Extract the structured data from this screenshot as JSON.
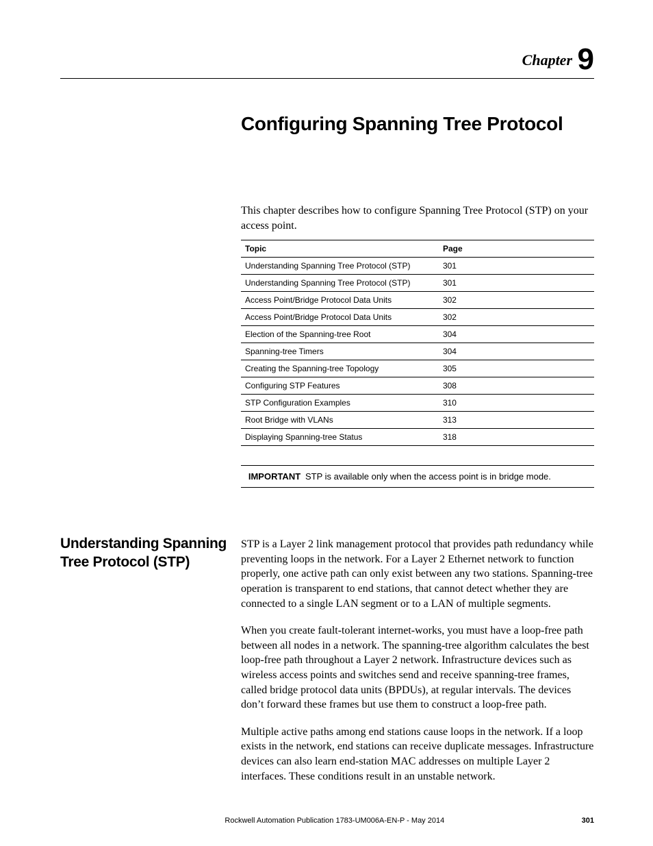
{
  "header": {
    "chapter_word": "Chapter",
    "chapter_num": "9"
  },
  "title": "Configuring Spanning Tree Protocol",
  "intro": "This chapter describes how to configure Spanning Tree Protocol (STP) on your access point.",
  "topics_table": {
    "head_topic": "Topic",
    "head_page": "Page",
    "rows": [
      {
        "t": "Understanding Spanning Tree Protocol (STP)",
        "p": "301"
      },
      {
        "t": "Understanding Spanning Tree Protocol (STP)",
        "p": "301"
      },
      {
        "t": "Access Point/Bridge Protocol Data Units",
        "p": "302"
      },
      {
        "t": "Access Point/Bridge Protocol Data Units",
        "p": "302"
      },
      {
        "t": "Election of the Spanning-tree Root",
        "p": "304"
      },
      {
        "t": "Spanning-tree Timers",
        "p": "304"
      },
      {
        "t": "Creating the Spanning-tree Topology",
        "p": "305"
      },
      {
        "t": "Configuring STP Features",
        "p": "308"
      },
      {
        "t": "STP Configuration Examples",
        "p": "310"
      },
      {
        "t": "Root Bridge with VLANs",
        "p": "313"
      },
      {
        "t": "Displaying Spanning-tree Status",
        "p": "318"
      }
    ]
  },
  "important": {
    "label": "IMPORTANT",
    "text": "STP is available only when the access point is in bridge mode."
  },
  "section": {
    "heading": "Understanding Spanning Tree Protocol (STP)",
    "p1": "STP is a Layer 2 link management protocol that provides path redundancy while preventing loops in the network. For a Layer 2 Ethernet network to function properly, one active path can only exist between any two stations. Spanning-tree operation is transparent to end stations, that cannot detect whether they are connected to a single LAN segment or to a LAN of multiple segments.",
    "p2": "When you create fault-tolerant internet-works, you must have a loop-free path between all nodes in a network. The spanning-tree algorithm calculates the best loop-free path throughout a Layer 2 network. Infrastructure devices such as wireless access points and switches send and receive spanning-tree frames, called bridge protocol data units (BPDUs), at regular intervals. The devices don’t forward these frames but use them to construct a loop-free path.",
    "p3": "Multiple active paths among end stations cause loops in the network. If a loop exists in the network, end stations can receive duplicate messages. Infrastructure devices can also learn end-station MAC addresses on multiple Layer 2 interfaces. These conditions result in an unstable network."
  },
  "footer": {
    "publication": "Rockwell Automation Publication 1783-UM006A-EN-P - May 2014",
    "page": "301"
  }
}
